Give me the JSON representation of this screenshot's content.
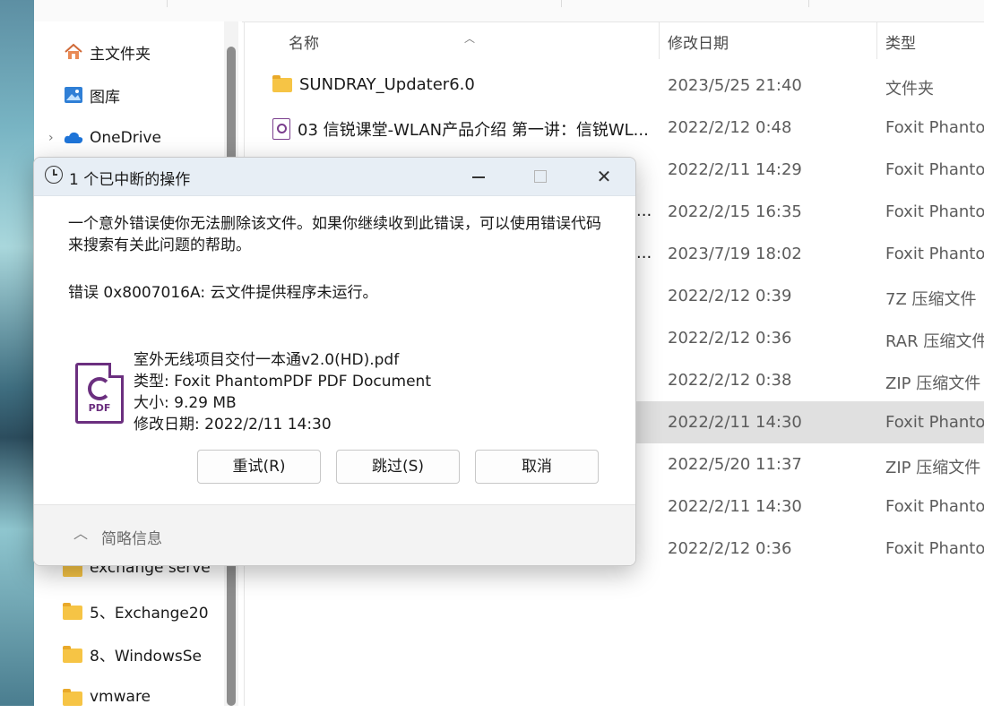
{
  "columns": {
    "name": "名称",
    "date": "修改日期",
    "type": "类型"
  },
  "nav": [
    {
      "label": "主文件夹",
      "icon": "home-icon"
    },
    {
      "label": "图库",
      "icon": "gallery-icon"
    },
    {
      "label": "OneDrive",
      "icon": "cloud-icon"
    },
    {
      "label": "exchange serve",
      "icon": "folder-icon"
    },
    {
      "label": "5、Exchange20",
      "icon": "folder-icon"
    },
    {
      "label": "8、WindowsSe",
      "icon": "folder-icon"
    },
    {
      "label": "vmware",
      "icon": "folder-icon"
    }
  ],
  "files": [
    {
      "name": "SUNDRAY_Updater6.0",
      "date": "2023/5/25 21:40",
      "type": "文件夹"
    },
    {
      "name": "03 信锐课堂-WLAN产品介绍 第一讲：信锐WL...",
      "date": "2022/2/12 0:48",
      "type": "Foxit Phanton"
    },
    {
      "name": "",
      "date": "2022/2/11 14:29",
      "type": "Foxit Phanton"
    },
    {
      "name": "...",
      "date": "2022/2/15 16:35",
      "type": "Foxit Phanton"
    },
    {
      "name": "...",
      "date": "2023/7/19 18:02",
      "type": "Foxit Phanton"
    },
    {
      "name": "",
      "date": "2022/2/12 0:39",
      "type": "7Z 压缩文件"
    },
    {
      "name": "",
      "date": "2022/2/12 0:36",
      "type": "RAR 压缩文件"
    },
    {
      "name": "",
      "date": "2022/2/12 0:38",
      "type": "ZIP 压缩文件"
    },
    {
      "name": "",
      "date": "2022/2/11 14:30",
      "type": "Foxit Phanton"
    },
    {
      "name": "",
      "date": "2022/5/20 11:37",
      "type": "ZIP 压缩文件"
    },
    {
      "name": "",
      "date": "2022/2/11 14:30",
      "type": "Foxit Phanton"
    },
    {
      "name": "",
      "date": "2022/2/12 0:36",
      "type": "Foxit Phanton"
    }
  ],
  "dialog": {
    "title": "1 个已中断的操作",
    "message": "一个意外错误使你无法删除该文件。如果你继续收到此错误，可以使用错误代码来搜索有关此问题的帮助。",
    "error": "错误 0x8007016A: 云文件提供程序未运行。",
    "file_icon_label": "PDF",
    "file_name": "室外无线项目交付一本通v2.0(HD).pdf",
    "file_type": "类型: Foxit PhantomPDF PDF Document",
    "file_size": "大小: 9.29 MB",
    "file_modified": "修改日期: 2022/2/11 14:30",
    "retry_label": "重试(R)",
    "skip_label": "跳过(S)",
    "cancel_label": "取消",
    "details_label": "简略信息",
    "close_glyph": "✕"
  }
}
